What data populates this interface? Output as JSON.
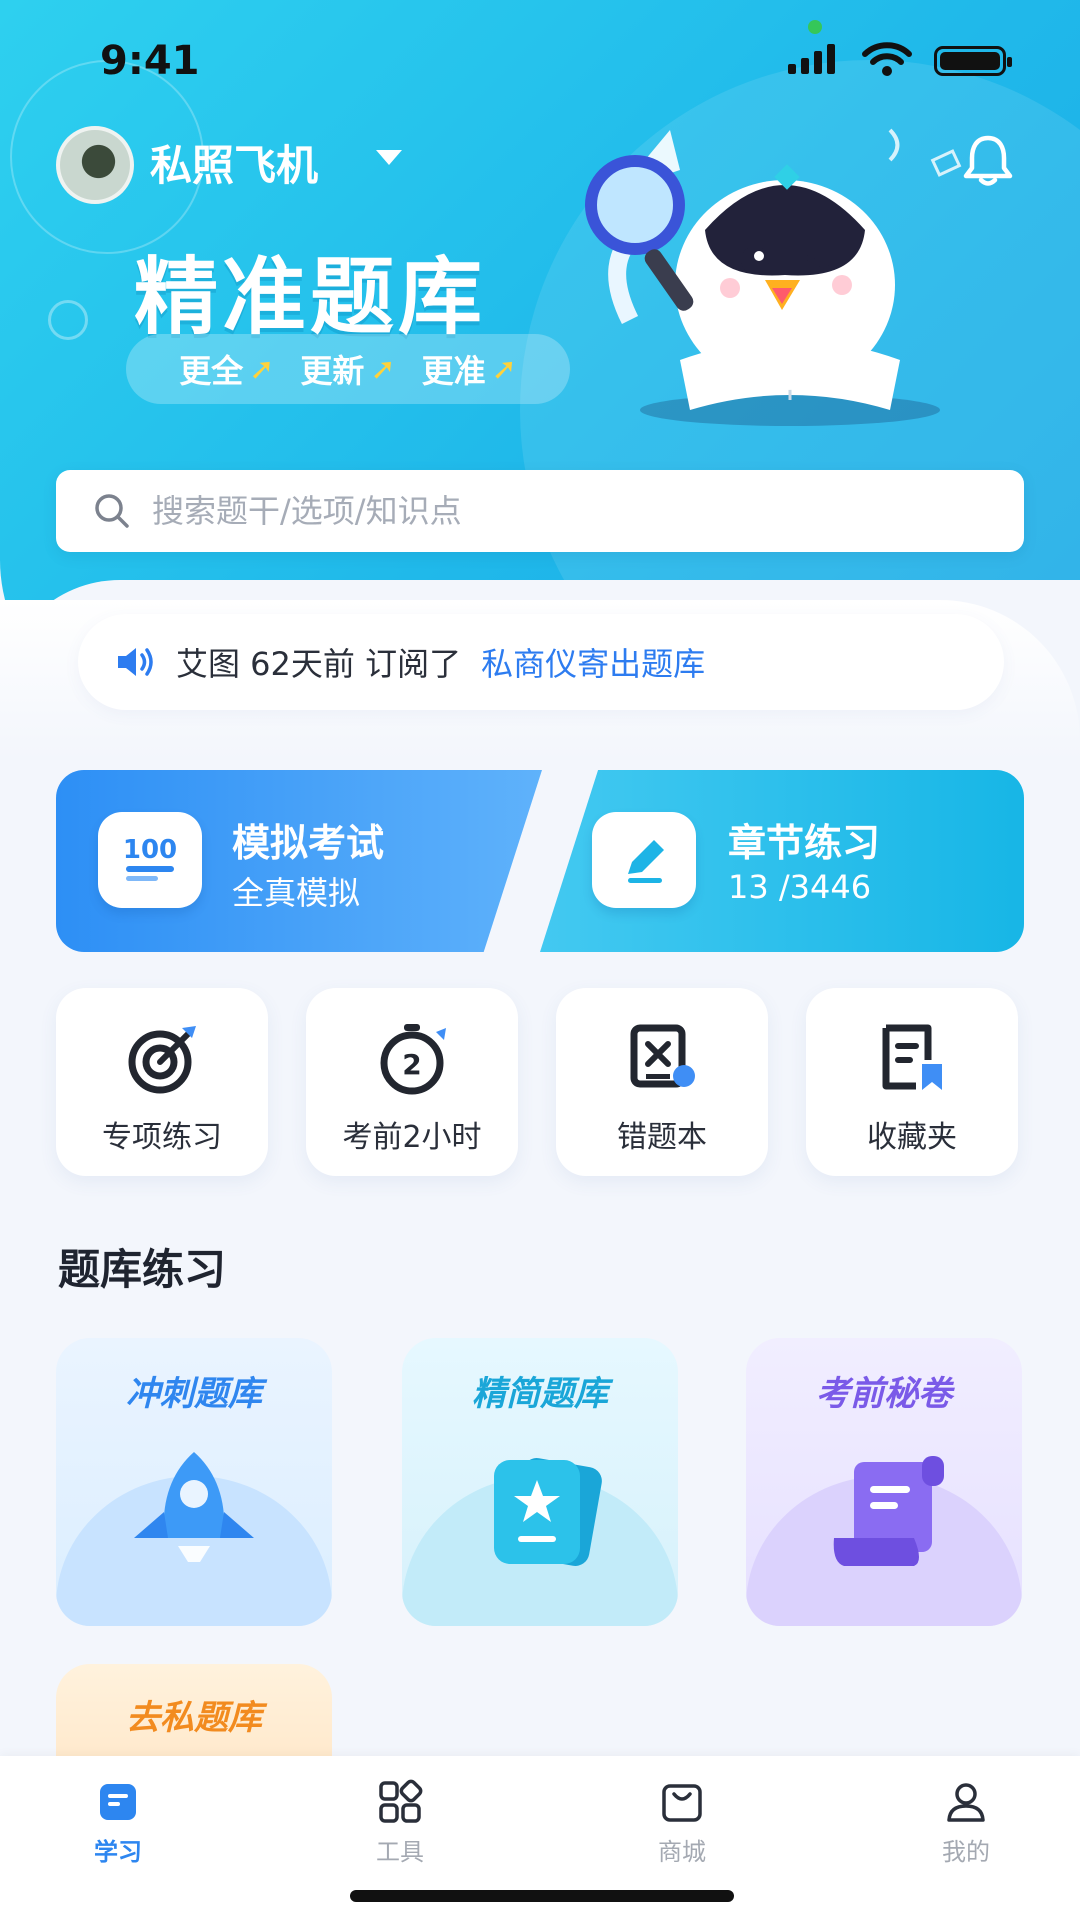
{
  "status_bar": {
    "time": "9:41"
  },
  "profile": {
    "name": "私照飞机"
  },
  "hero": {
    "title": "精准题库",
    "tags": [
      "更全",
      "更新",
      "更准"
    ]
  },
  "search": {
    "placeholder": "搜索题干/选项/知识点"
  },
  "notice": {
    "text": "艾图 62天前 订阅了",
    "link": "私商仪寄出题库"
  },
  "main_cards": [
    {
      "title": "模拟考试",
      "subtitle": "全真模拟",
      "icon": "score-100-icon"
    },
    {
      "title": "章节练习",
      "subtitle": "13 /3446",
      "icon": "pencil-icon"
    }
  ],
  "quick_tiles": [
    {
      "label": "专项练习",
      "icon": "target-icon"
    },
    {
      "label": "考前2小时",
      "icon": "stopwatch-icon"
    },
    {
      "label": "错题本",
      "icon": "wrong-book-icon"
    },
    {
      "label": "收藏夹",
      "icon": "favorites-icon"
    }
  ],
  "section": {
    "title": "题库练习"
  },
  "banks": [
    {
      "name": "冲刺题库",
      "icon": "rocket-icon"
    },
    {
      "name": "精简题库",
      "icon": "star-card-icon"
    },
    {
      "name": "考前秘卷",
      "icon": "scroll-icon"
    },
    {
      "name": "去私题库",
      "icon": ""
    }
  ],
  "tabbar": [
    {
      "label": "学习",
      "icon": "study-icon",
      "active": true
    },
    {
      "label": "工具",
      "icon": "tools-icon",
      "active": false
    },
    {
      "label": "商城",
      "icon": "shop-icon",
      "active": false
    },
    {
      "label": "我的",
      "icon": "profile-icon",
      "active": false
    }
  ],
  "colors": {
    "brand": "#20b9ea",
    "accent_blue": "#2d86f0",
    "arrow_yellow": "#ffd23a"
  }
}
